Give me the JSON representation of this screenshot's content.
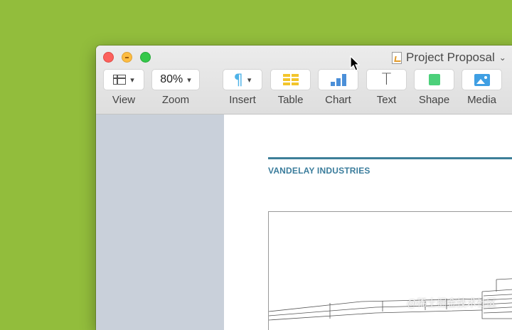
{
  "window": {
    "doc_title": "Project Proposal"
  },
  "toolbar": {
    "view": {
      "label": "View"
    },
    "zoom": {
      "label": "Zoom",
      "value": "80%"
    },
    "insert": {
      "label": "Insert"
    },
    "table": {
      "label": "Table"
    },
    "chart": {
      "label": "Chart"
    },
    "text": {
      "label": "Text"
    },
    "shape": {
      "label": "Shape"
    },
    "media": {
      "label": "Media"
    }
  },
  "document": {
    "company": "VANDELAY INDUSTRIES"
  },
  "watermark": "@稀土掘金技术社区",
  "colors": {
    "desktop": "#92bd3c",
    "accent": "#3d7f98",
    "sidebar": "#c9d0da"
  }
}
